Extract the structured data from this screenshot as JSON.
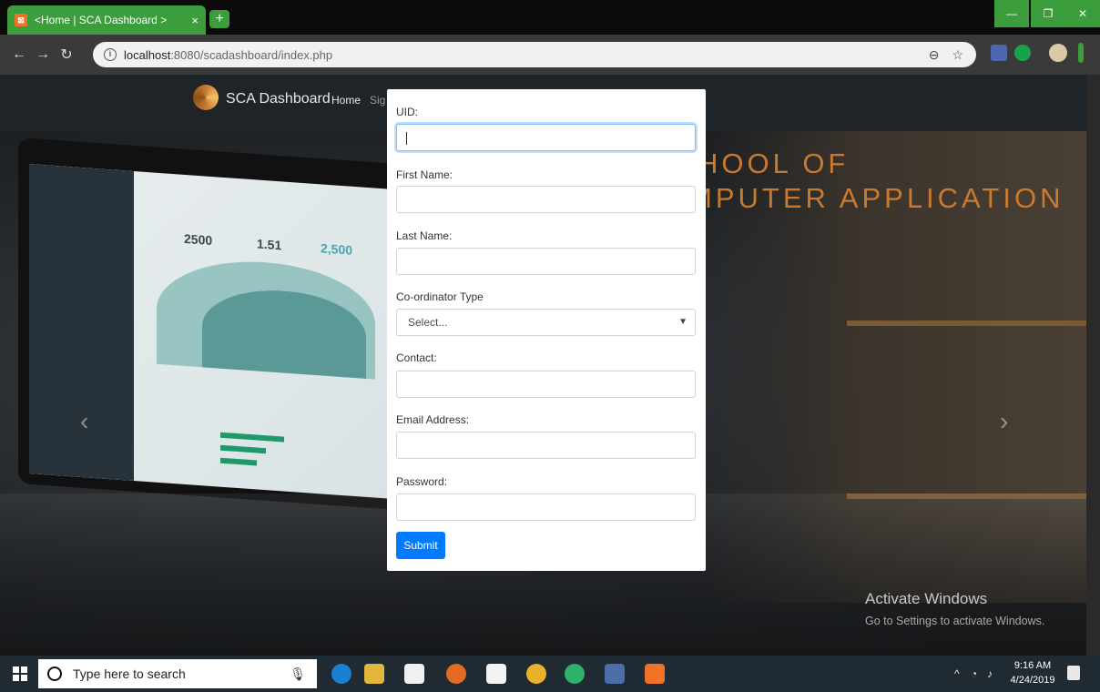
{
  "browser": {
    "tab_title": "<Home | SCA Dashboard >",
    "tab_close": "×",
    "new_tab": "+",
    "url_host": "localhost",
    "url_path": ":8080/scadashboard/index.php",
    "win_minimize": "—",
    "win_restore": "❐",
    "win_close": "✕"
  },
  "navbar": {
    "brand": "SCA Dashboard",
    "home": "Home",
    "sign": "Sig"
  },
  "hero": {
    "line1": "HOOL OF",
    "line2": "MPUTER APPLICATION",
    "prev": "‹",
    "next": "›"
  },
  "laptop": {
    "stat1": "2500",
    "stat2": "1.51",
    "stat3": "2,500"
  },
  "form": {
    "uid_label": "UID:",
    "first_name_label": "First Name:",
    "last_name_label": "Last Name:",
    "coordinator_label": "Co-ordinator Type",
    "coordinator_selected": "Select...",
    "contact_label": "Contact:",
    "email_label": "Email Address:",
    "password_label": "Password:",
    "submit_label": "Submit"
  },
  "watermark": {
    "title": "Activate Windows",
    "subtitle": "Go to Settings to activate Windows."
  },
  "taskbar": {
    "search_placeholder": "Type here to search",
    "time": "9:16 AM",
    "date": "4/24/2019"
  },
  "colors": {
    "primary_button": "#007bff",
    "accent_green": "#3c9d3c",
    "heading_orange": "#c97a2e"
  }
}
